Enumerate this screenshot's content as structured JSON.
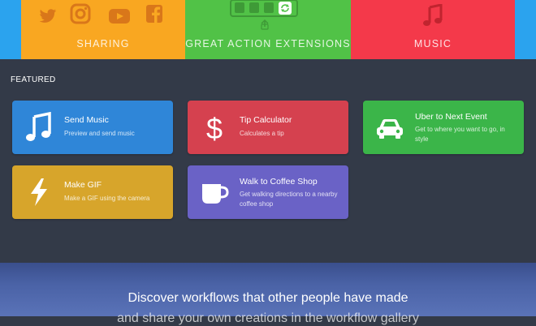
{
  "banners": {
    "sharing_label": "SHARING",
    "actions_label": "GREAT ACTION EXTENSIONS",
    "music_label": "MUSIC"
  },
  "featured": {
    "title": "FEATURED",
    "cards": [
      {
        "title": "Send Music",
        "desc": "Preview and send music",
        "color": "#2f86d8",
        "icon": "music-note-icon"
      },
      {
        "title": "Tip Calculator",
        "desc": "Calculates a tip",
        "color": "#d5414f",
        "icon": "dollar-icon"
      },
      {
        "title": "Uber to Next Event",
        "desc": "Get to where you want to go, in style",
        "color": "#3bb549",
        "icon": "car-icon"
      },
      {
        "title": "Make GIF",
        "desc": "Make a GIF using the camera",
        "color": "#d7a52b",
        "icon": "lightning-icon"
      },
      {
        "title": "Walk to Coffee Shop",
        "desc": "Get walking directions to a nearby coffee shop",
        "color": "#6a62c6",
        "icon": "coffee-cup-icon"
      }
    ]
  },
  "discover": {
    "line1": "Discover workflows that other people have made",
    "line2": "and share your own creations in the workflow gallery"
  }
}
